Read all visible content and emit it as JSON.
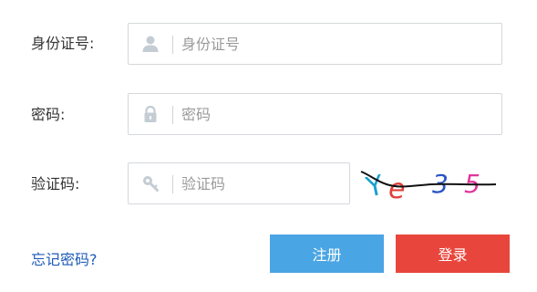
{
  "form": {
    "id_label": "身份证号:",
    "id_placeholder": "身份证号",
    "password_label": "密码:",
    "password_placeholder": "密码",
    "captcha_label": "验证码:",
    "captcha_placeholder": "验证码",
    "captcha_text": [
      "Y",
      "e",
      "3",
      "5"
    ]
  },
  "links": {
    "forgot_password": "忘记密码?"
  },
  "buttons": {
    "register": "注册",
    "login": "登录"
  },
  "colors": {
    "register_bg": "#4aa5e4",
    "login_bg": "#e8463c",
    "link": "#1e5bb8"
  },
  "icons": {
    "id_field": "user-icon",
    "password_field": "lock-icon",
    "captcha_field": "key-icon"
  }
}
